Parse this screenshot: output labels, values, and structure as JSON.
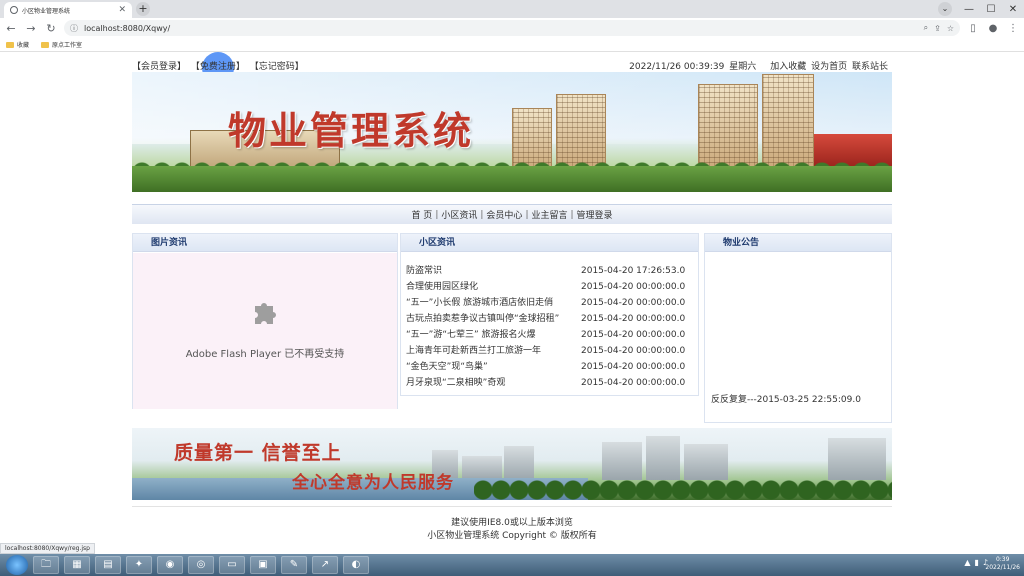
{
  "browser": {
    "tab_title": "小区物业管理系统",
    "url": "localhost:8080/Xqwy/",
    "bookmarks": [
      "收藏",
      "原点工作室"
    ],
    "status_url": "localhost:8080/Xqwy/reg.jsp"
  },
  "header": {
    "login": "【会员登录】",
    "register": "【免费注册】",
    "forgot": "【忘记密码】",
    "datetime": "2022/11/26 00:39:39",
    "weekday": "星期六",
    "add_favorite": "加入收藏",
    "set_home": "设为首页",
    "contact": "联系站长"
  },
  "banner": {
    "title": "物业管理系统"
  },
  "nav": {
    "items": [
      "首 页",
      "小区资讯",
      "会员中心",
      "业主留言",
      "管理登录"
    ]
  },
  "panels": {
    "images": {
      "title": "图片资讯",
      "flash_msg": "Adobe Flash Player 已不再受支持"
    },
    "news": {
      "title": "小区资讯",
      "rows": [
        {
          "title": "防盗常识",
          "date": "2015-04-20 17:26:53.0"
        },
        {
          "title": "合理使用园区绿化",
          "date": "2015-04-20 00:00:00.0"
        },
        {
          "title": "“五一”小长假 旅游城市酒店依旧走俏",
          "date": "2015-04-20 00:00:00.0"
        },
        {
          "title": "古玩点拍卖惹争议古镇叫停“金球招租”",
          "date": "2015-04-20 00:00:00.0"
        },
        {
          "title": "“五一”游“七荤三” 旅游报名火爆",
          "date": "2015-04-20 00:00:00.0"
        },
        {
          "title": "上海青年可赴新西兰打工旅游一年",
          "date": "2015-04-20 00:00:00.0"
        },
        {
          "title": "“金色天空”现“鸟巢”",
          "date": "2015-04-20 00:00:00.0"
        },
        {
          "title": "月牙泉现“二泉相映”奇观",
          "date": "2015-04-20 00:00:00.0"
        }
      ]
    },
    "notice": {
      "title": "物业公告",
      "item": "反反复复---2015-03-25 22:55:09.0"
    }
  },
  "slogan": {
    "line1": "质量第一   信誉至上",
    "line2": "全心全意为人民服务"
  },
  "footer": {
    "line1": "建议使用IE8.0或以上版本浏览",
    "line2": "小区物业管理系统 Copyright © 版权所有"
  },
  "taskbar": {
    "time": "0:39",
    "date": "2022/11/26"
  }
}
